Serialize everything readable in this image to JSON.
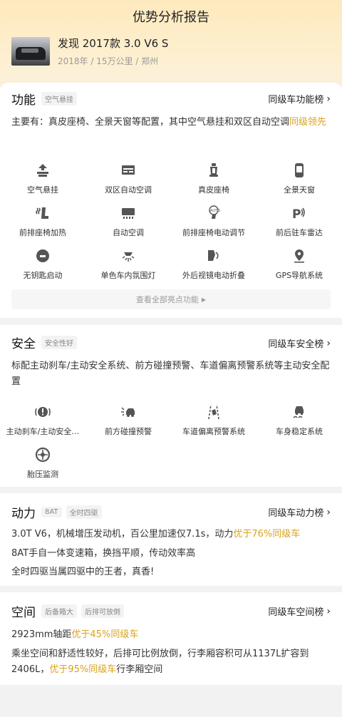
{
  "header": {
    "title": "优势分析报告",
    "car_name": "发现 2017款 3.0 V6 S",
    "car_meta": "2018年 / 15万公里 / 郑州"
  },
  "function": {
    "title": "功能",
    "tag": "空气悬挂",
    "rank_label": "同级车功能榜",
    "desc_main": "主要有：真皮座椅、全景天窗等配置，其中空气悬挂和双区自动空调",
    "desc_highlight": "同级领先",
    "items": [
      {
        "label": "空气悬挂",
        "icon": "air-suspension-icon"
      },
      {
        "label": "双区自动空调",
        "icon": "dual-zone-ac-icon"
      },
      {
        "label": "真皮座椅",
        "icon": "leather-seat-icon"
      },
      {
        "label": "全景天窗",
        "icon": "panoramic-sunroof-icon"
      },
      {
        "label": "前排座椅加热",
        "icon": "seat-heating-icon"
      },
      {
        "label": "自动空调",
        "icon": "auto-ac-icon"
      },
      {
        "label": "前排座椅电动调节",
        "icon": "power-seat-icon"
      },
      {
        "label": "前后驻车雷达",
        "icon": "parking-radar-icon"
      },
      {
        "label": "无钥匙启动",
        "icon": "keyless-start-icon"
      },
      {
        "label": "单色车内氛围灯",
        "icon": "ambient-light-icon"
      },
      {
        "label": "外后视镜电动折叠",
        "icon": "mirror-fold-icon"
      },
      {
        "label": "GPS导航系统",
        "icon": "gps-nav-icon"
      }
    ],
    "see_all": "查看全部亮点功能"
  },
  "safety": {
    "title": "安全",
    "tag": "安全性好",
    "rank_label": "同级车安全榜",
    "desc": "标配主动刹车/主动安全系统、前方碰撞预警、车道偏离预警系统等主动安全配置",
    "items": [
      {
        "label": "主动刹车/主动安全…",
        "icon": "active-brake-icon"
      },
      {
        "label": "前方碰撞预警",
        "icon": "collision-warning-icon"
      },
      {
        "label": "车道偏离预警系统",
        "icon": "lane-departure-icon"
      },
      {
        "label": "车身稳定系统",
        "icon": "stability-control-icon"
      },
      {
        "label": "胎压监测",
        "icon": "tire-pressure-icon"
      }
    ]
  },
  "power": {
    "title": "动力",
    "tags": [
      "8AT",
      "全时四驱"
    ],
    "rank_label": "同级车动力榜",
    "line1_main": "3.0T V6，机械增压发动机，百公里加速仅7.1s，动力",
    "line1_highlight": "优于76%同级车",
    "line2": "8AT手自一体变速箱，换挡平顺，传动效率高",
    "line3": "全时四驱当属四驱中的王者，真香!"
  },
  "space": {
    "title": "空间",
    "tags": [
      "后备箱大",
      "后排可放倒"
    ],
    "rank_label": "同级车空间榜",
    "line1_main": "2923mm轴距",
    "line1_highlight": "优于45%同级车",
    "line2_main": "乘坐空间和舒适性较好，后排可比例放倒，行李厢容积可从1137L扩容到2406L，",
    "line2_highlight": "优于95%同级车",
    "line2_tail": "行李厢空间"
  },
  "colors": {
    "accent_gold": "#d9a21b",
    "header_gradient_top": "#fde9bd"
  }
}
